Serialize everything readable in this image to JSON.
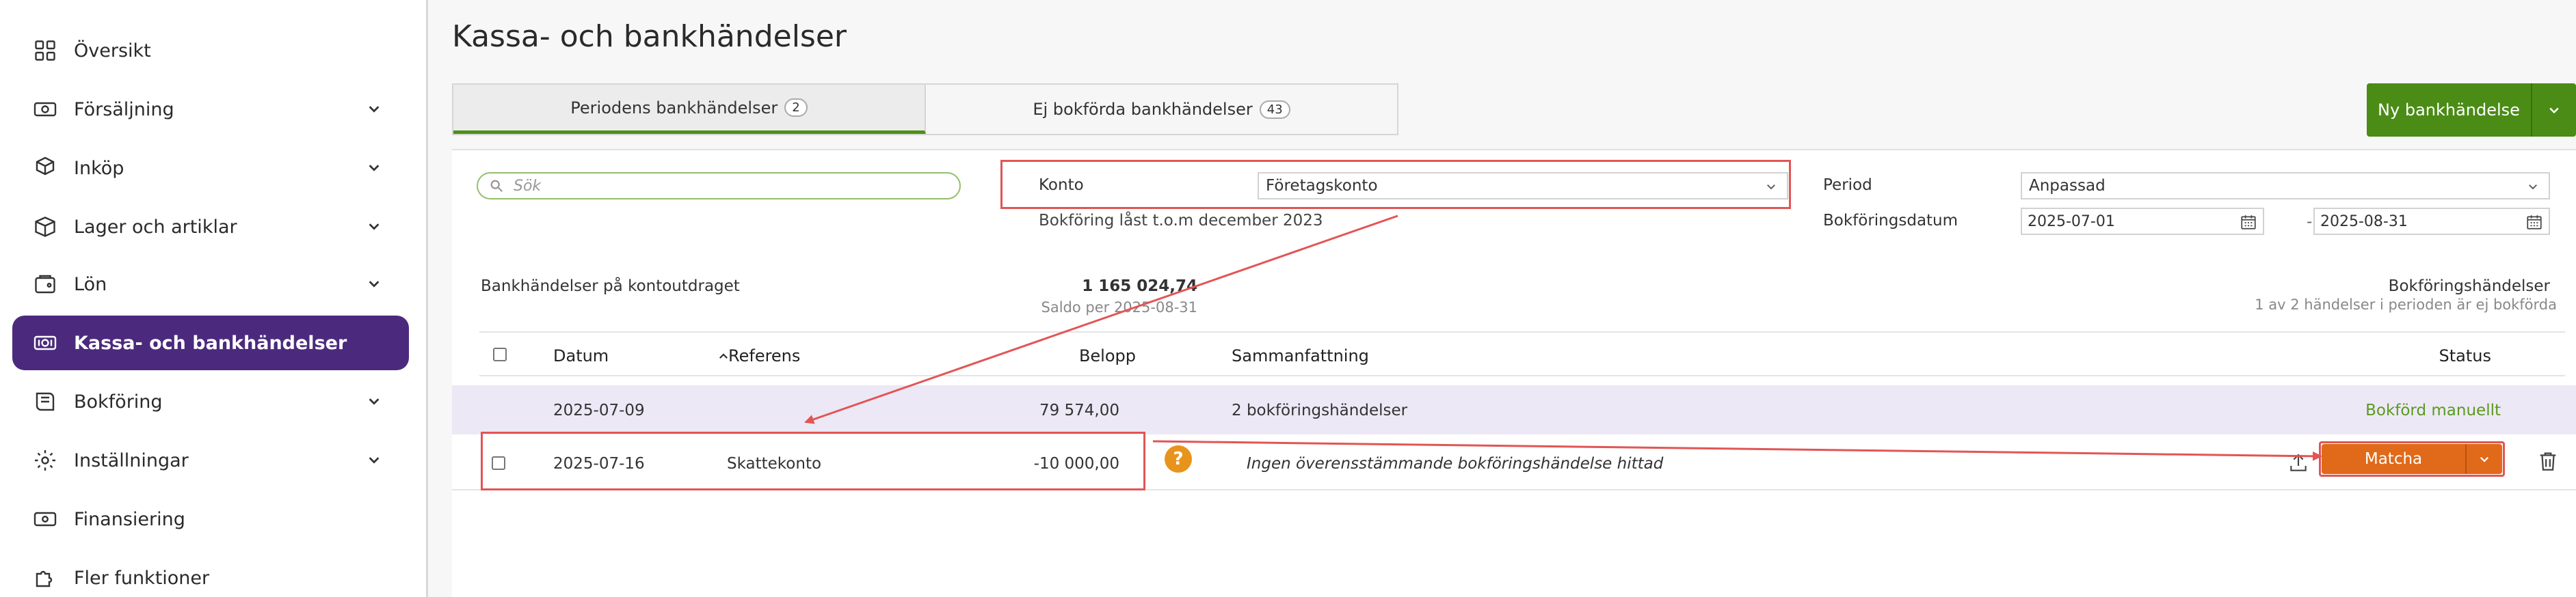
{
  "sidebar": {
    "items": [
      {
        "label": "Översikt",
        "icon": "dashboard-icon"
      },
      {
        "label": "Försäljning",
        "icon": "cash-register-icon",
        "expandable": true
      },
      {
        "label": "Inköp",
        "icon": "boxes-icon",
        "expandable": true
      },
      {
        "label": "Lager och artiklar",
        "icon": "box-icon",
        "expandable": true
      },
      {
        "label": "Lön",
        "icon": "wallet-icon",
        "expandable": true
      },
      {
        "label": "Kassa- och bankhändelser",
        "icon": "bank-icon",
        "active": true
      },
      {
        "label": "Bokföring",
        "icon": "book-icon",
        "expandable": true
      },
      {
        "label": "Inställningar",
        "icon": "gear-icon",
        "expandable": true
      },
      {
        "label": "Finansiering",
        "icon": "money-icon"
      },
      {
        "label": "Fler funktioner",
        "icon": "puzzle-icon"
      }
    ]
  },
  "header": {
    "title": "Kassa- och bankhändelser"
  },
  "tabs": [
    {
      "label": "Periodens bankhändelser",
      "count": "2",
      "active": true
    },
    {
      "label": "Ej bokförda bankhändelser",
      "count": "43"
    }
  ],
  "new_button": {
    "label": "Ny bankhändelse"
  },
  "filters": {
    "search_placeholder": "Sök",
    "konto_label": "Konto",
    "konto_value": "Företagskonto",
    "lock_note": "Bokföring låst t.o.m december 2023",
    "period_label": "Period",
    "period_value": "Anpassad",
    "date_label": "Bokföringsdatum",
    "date_from": "2025-07-01",
    "date_sep": "-",
    "date_to": "2025-08-31"
  },
  "summary": {
    "left_label": "Bankhändelser på kontoutdraget",
    "balance": "1 165 024,74",
    "balance_note": "Saldo per 2025-08-31",
    "right_label": "Bokföringshändelser",
    "right_note": "1 av 2 händelser i perioden är ej bokförda"
  },
  "table": {
    "headers": {
      "date": "Datum",
      "ref": "Referens",
      "amount": "Belopp",
      "summary": "Sammanfattning",
      "status": "Status"
    },
    "rows": [
      {
        "date": "2025-07-09",
        "ref": "",
        "amount": "79 574,00",
        "summary": "2 bokföringshändelser",
        "status": "Bokförd manuellt"
      },
      {
        "date": "2025-07-16",
        "ref": "Skattekonto",
        "amount": "-10 000,00",
        "summary": "Ingen överensstämmande bokföringshändelse hittad",
        "action": "Matcha"
      }
    ]
  },
  "colors": {
    "sidebar_active": "#4b2a7d",
    "primary_green": "#4a8c16",
    "status_green": "#5a9a1e",
    "match_orange": "#e06a1a",
    "annotation_red": "#e25555",
    "row_highlight": "#ede8f6"
  }
}
